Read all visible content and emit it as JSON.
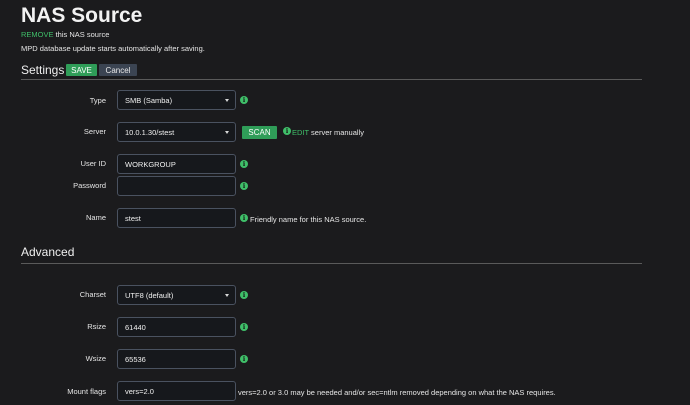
{
  "page": {
    "title": "NAS Source",
    "remove_link": "REMOVE",
    "remove_suffix": " this NAS source",
    "update_note": "MPD database update starts automatically after saving."
  },
  "settings": {
    "heading": "Settings",
    "save_label": "SAVE",
    "cancel_label": "Cancel",
    "type": {
      "label": "Type",
      "value": "SMB (Samba)"
    },
    "server": {
      "label": "Server",
      "value": "10.0.1.30/stest",
      "scan_label": "SCAN",
      "edit_link": "EDIT",
      "edit_suffix": " server manually"
    },
    "user_id": {
      "label": "User ID",
      "value": "WORKGROUP"
    },
    "password": {
      "label": "Password",
      "value": ""
    },
    "name": {
      "label": "Name",
      "value": "stest",
      "help": "Friendly name for this NAS source."
    }
  },
  "advanced": {
    "heading": "Advanced",
    "charset": {
      "label": "Charset",
      "value": "UTF8 (default)"
    },
    "rsize": {
      "label": "Rsize",
      "value": "61440"
    },
    "wsize": {
      "label": "Wsize",
      "value": "65536"
    },
    "mount_flags": {
      "label": "Mount flags",
      "value": "vers=2.0",
      "help": "vers=2.0 or 3.0 may be needed and/or sec=ntlm removed depending on what the NAS requires."
    }
  },
  "colors": {
    "background": "#1b1b1d",
    "accent_green": "#3fbf69",
    "button_green": "#2f9d58",
    "cancel_bg": "#3b4452"
  }
}
